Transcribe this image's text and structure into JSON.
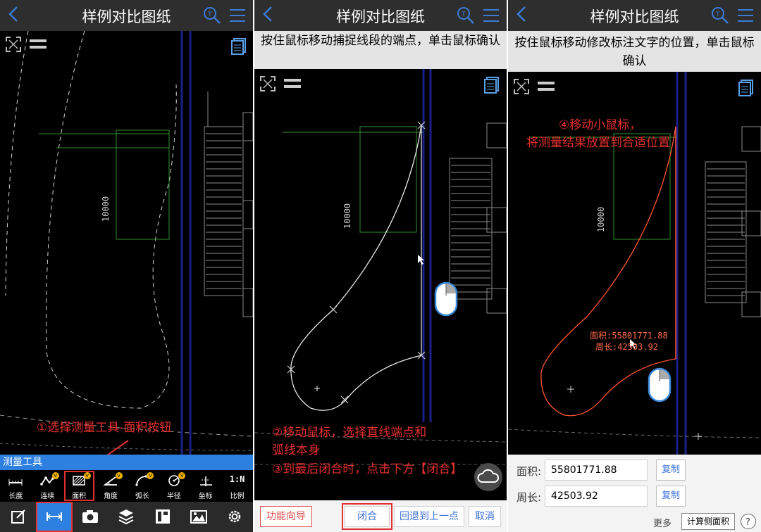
{
  "app_title": "样例对比图纸",
  "panel1": {
    "annotation": "①选择测量工具-面积按钮",
    "toolbar_title": "测量工具",
    "tools": [
      {
        "label": "长度",
        "icon": "length-icon"
      },
      {
        "label": "连续",
        "icon": "continuous-icon"
      },
      {
        "label": "面积",
        "icon": "area-icon"
      },
      {
        "label": "角度",
        "icon": "angle-icon"
      },
      {
        "label": "弧长",
        "icon": "arc-length-icon"
      },
      {
        "label": "半径",
        "icon": "radius-icon"
      },
      {
        "label": "坐标",
        "icon": "coordinate-icon"
      },
      {
        "label": "比例",
        "icon": "scale-icon"
      }
    ],
    "scale_glyph": "1:N",
    "dim_text": "10000"
  },
  "panel2": {
    "instruction": "按住鼠标移动捕捉线段的端点，单击鼠标确认",
    "annotation_lines": [
      "②移动鼠标，选择直线端点和",
      "弧线本身",
      "③到最后闭合时，点击下方【闭合】"
    ],
    "buttons": {
      "guide": "功能向导",
      "close": "闭合",
      "undo": "回退到上一点",
      "cancel": "取消"
    },
    "dim_text": "10000"
  },
  "panel3": {
    "instruction": "按住鼠标移动修改标注文字的位置，单击鼠标确认",
    "annotation_lines": [
      "④移动小鼠标，",
      "将测量结果放置到合适位置"
    ],
    "cad_area_text": "面积:55801771.88",
    "cad_perim_text": "周长:42503.92",
    "area_label": "面积:",
    "area_value": "55801771.88",
    "perimeter_label": "周长:",
    "perimeter_value": "42503.92",
    "copy_label": "复制",
    "more_label": "更多",
    "calc_label": "计算侧面积",
    "dim_text": "10000"
  },
  "colors": {
    "accent": "#2d7fe0",
    "annotation": "#e53030",
    "measure_line": "#ff5533"
  }
}
